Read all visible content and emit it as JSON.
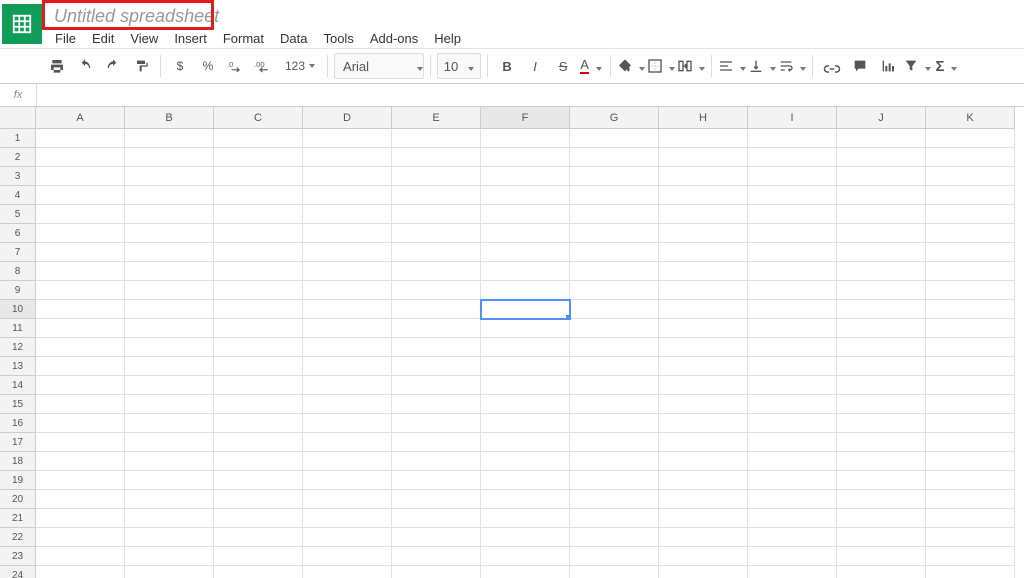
{
  "app": {
    "title": "Untitled spreadsheet",
    "menus": [
      "File",
      "Edit",
      "View",
      "Insert",
      "Format",
      "Data",
      "Tools",
      "Add-ons",
      "Help"
    ]
  },
  "toolbar": {
    "currency": "$",
    "percent": "%",
    "dec_decrease": ".0←",
    "dec_increase": ".00→",
    "more_formats": "123",
    "font_name": "Arial",
    "font_size": "10",
    "bold": "B",
    "italic": "I",
    "strike": "S",
    "text_color_letter": "A"
  },
  "formula_bar": {
    "fx_label": "fx",
    "value": ""
  },
  "grid": {
    "columns": [
      "A",
      "B",
      "C",
      "D",
      "E",
      "F",
      "G",
      "H",
      "I",
      "J",
      "K"
    ],
    "rows": [
      "1",
      "2",
      "3",
      "4",
      "5",
      "6",
      "7",
      "8",
      "9",
      "10",
      "11",
      "12",
      "13",
      "14",
      "15",
      "16",
      "17",
      "18",
      "19",
      "20",
      "21",
      "22",
      "23",
      "24"
    ],
    "selected_cell": {
      "row_index": 9,
      "col_index": 5
    }
  }
}
